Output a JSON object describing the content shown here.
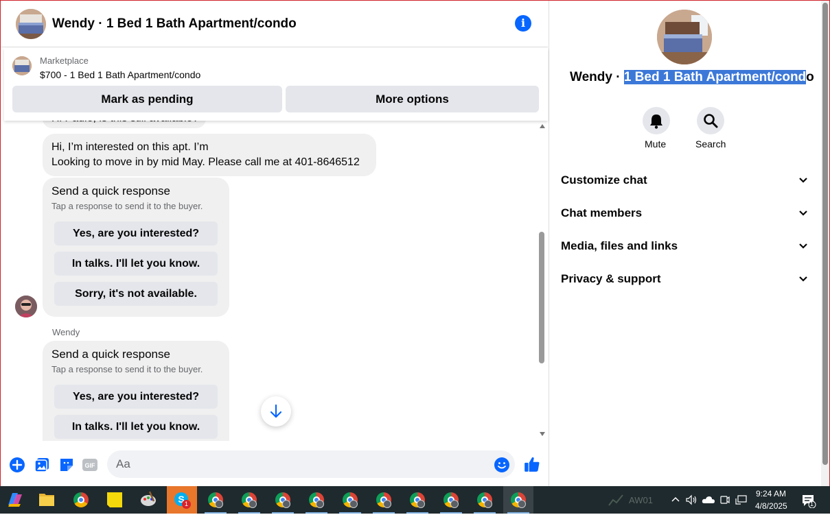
{
  "header": {
    "title": "Wendy · 1 Bed 1 Bath Apartment/condo"
  },
  "marketplace": {
    "label": "Marketplace",
    "listing": "$700 - 1 Bed 1 Bath Apartment/condo",
    "pending_label": "Mark as pending",
    "more_label": "More options"
  },
  "thread": {
    "partial_message": "Hi Padie, is this still available?",
    "message_lines": [
      "Hi, I’m interested on this apt. I’m",
      "Looking to move in by mid May. Please call me at 401-8646512"
    ],
    "quick1": {
      "title": "Send a quick response",
      "subtitle": "Tap a response to send it to the buyer.",
      "options": [
        "Yes, are you interested?",
        "In talks. I'll let you know.",
        "Sorry, it's not available."
      ]
    },
    "sender": "Wendy",
    "quick2": {
      "title": "Send a quick response",
      "subtitle": "Tap a response to send it to the buyer.",
      "options": [
        "Yes, are you interested?",
        "In talks. I'll let you know."
      ]
    }
  },
  "composer": {
    "placeholder": "Aa"
  },
  "details": {
    "name_prefix": "Wendy · ",
    "name_highlight": "1 Bed 1 Bath Apartment/cond",
    "name_suffix": "o",
    "mute_label": "Mute",
    "search_label": "Search",
    "sections": [
      "Customize chat",
      "Chat members",
      "Media, files and links",
      "Privacy & support"
    ]
  },
  "taskbar": {
    "skype_badge": "1",
    "tray_label": "AW01",
    "time": "9:24 AM",
    "date": "4/8/2025",
    "notification_count": "1"
  },
  "colors": {
    "accent": "#0866ff",
    "highlight": "#3c78d8",
    "taskbar": "#1f2a2e"
  }
}
